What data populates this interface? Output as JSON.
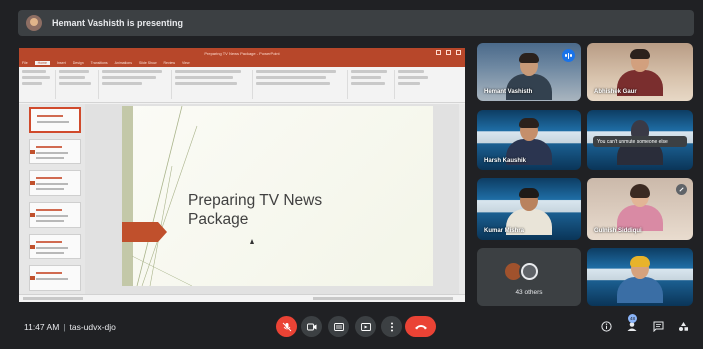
{
  "presenting_bar": {
    "text": "Hemant Vashisth is presenting"
  },
  "shared_screen": {
    "window_title": "Preparing TV News Package - PowerPoint",
    "ribbon_tabs": [
      "File",
      "Home",
      "Insert",
      "Design",
      "Transitions",
      "Animations",
      "Slide Show",
      "Review",
      "View"
    ],
    "slide_title_line1": "Preparing TV News",
    "slide_title_line2": "Package",
    "accent_color": "#c0502c"
  },
  "participants": [
    {
      "name": "Hemant Vashisth",
      "state": "speaking"
    },
    {
      "name": "Abhishek Gaur"
    },
    {
      "name": "Harsh Kaushik"
    },
    {
      "name": "",
      "message": "You can't unmute someone else"
    },
    {
      "name": "Kumar Mishra"
    },
    {
      "name": "Gulnish Siddiqui",
      "state": "muted"
    },
    {
      "others_count": "43 others"
    },
    {
      "name": ""
    }
  ],
  "meeting": {
    "time": "11:47 AM",
    "code": "tas-udvx-djo"
  },
  "controls": {
    "mic": "mic-off-icon",
    "camera": "camera-icon",
    "captions": "captions-icon",
    "present": "present-icon",
    "more": "more-icon",
    "leave": "leave-call-icon"
  },
  "right_controls": {
    "participants_badge": "48"
  },
  "colors": {
    "background": "#202124",
    "surface": "#3c4043",
    "danger": "#ea4335",
    "active_speaker": "#1a73e8"
  }
}
